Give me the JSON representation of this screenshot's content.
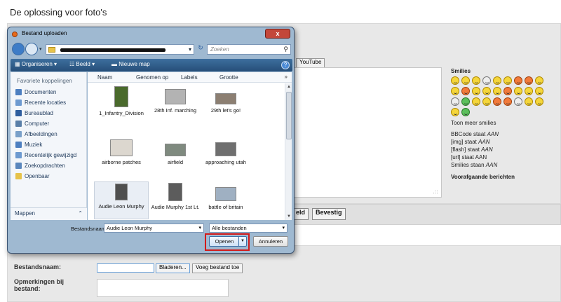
{
  "page": {
    "title": "De oplossing voor foto's",
    "youtube_button": "YouTube",
    "smilies": {
      "heading": "Smilies",
      "show_more": "Toon meer smilies",
      "bbcode_prefix": "BBCode staat ",
      "bbcode_state": "AAN",
      "img_prefix": "[img] staat ",
      "img_state": "AAN",
      "flash_prefix": "[flash] staat ",
      "flash_state": "AAN",
      "url_line": "[url] staat AAN",
      "smilies_prefix": "Smilies staan ",
      "smilies_state": "AAN",
      "previous_heading": "Voorafgaande berichten"
    },
    "actions": {
      "preview_fragment": "eld",
      "confirm": "Bevestig"
    },
    "attach": {
      "filename_label": "Bestandsnaam:",
      "browse": "Bladeren...",
      "add_file": "Voeg bestand toe",
      "remarks_label_1": "Opmerkingen bij",
      "remarks_label_2": "bestand:"
    }
  },
  "dialog": {
    "title": "Bestand uploaden",
    "close_label": "x",
    "search_placeholder": "Zoeken",
    "toolbar": {
      "organise": "Organiseren",
      "view": "Beeld",
      "new_folder": "Nieuwe map"
    },
    "nav": {
      "heading": "Favoriete koppelingen",
      "items": [
        "Documenten",
        "Recente locaties",
        "Bureaublad",
        "Computer",
        "Afbeeldingen",
        "Muziek",
        "Recentelijk gewijzigd",
        "Zoekopdrachten",
        "Openbaar"
      ],
      "folders_label": "Mappen"
    },
    "columns": [
      "Naam",
      "Genomen op",
      "Labels",
      "Grootte"
    ],
    "files": [
      "1_Infantry_Division",
      "28th Inf. marching",
      "29th let's go!",
      "airborne patches",
      "airfield",
      "approaching utah",
      "Audie Leon Murphy",
      "Audie Murphy 1st Lt.",
      "battle of britain"
    ],
    "filename_label": "Bestandsnaam:",
    "filename_value": "Audie Leon Murphy",
    "filetype_value": "Alle bestanden",
    "open_button": "Openen",
    "cancel_button": "Annuleren"
  }
}
